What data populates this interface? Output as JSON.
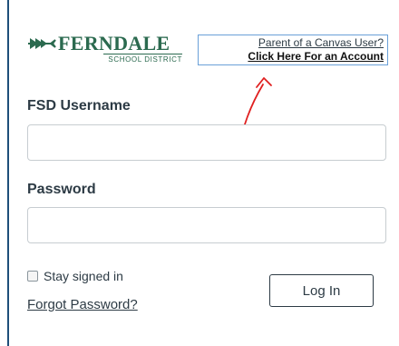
{
  "logo": {
    "name": "FERNDALE",
    "subtitle": "SCHOOL DISTRICT",
    "brand_color": "#2b6a4f"
  },
  "parent_link": {
    "line1": "Parent of a Canvas User?",
    "line2": "Click Here For an Account"
  },
  "annotation": {
    "arrow_color": "#e02020"
  },
  "form": {
    "username_label": "FSD Username",
    "username_value": "",
    "password_label": "Password",
    "password_value": "",
    "stay_signed_in_label": "Stay signed in",
    "stay_signed_in_checked": false,
    "forgot_password_label": "Forgot Password?",
    "login_button_label": "Log In"
  }
}
